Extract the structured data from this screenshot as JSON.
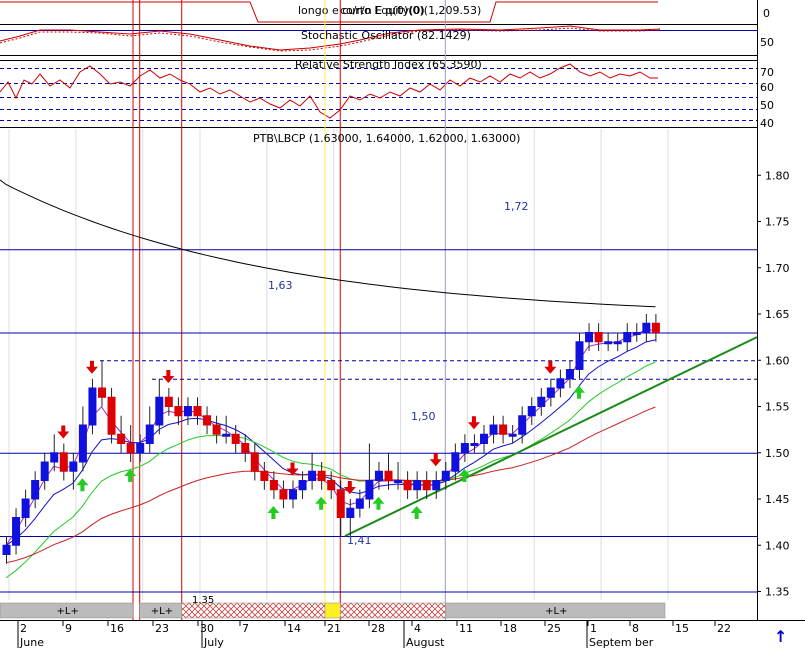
{
  "colors": {
    "up": "#1111dd",
    "down": "#dd0000",
    "sell_arrow": "#dd0000",
    "buy_arrow": "#22cc22",
    "sma_black": "#000000",
    "ema_fast": "#aa22cc",
    "ema_mid": "#1111cc",
    "ema_green": "#22cc22",
    "ema_red": "#cc2222",
    "trend": "#1a8a1a",
    "hline": "#0000aa",
    "vline_red": "#dd0000",
    "vline_yellow": "#ffee44",
    "vline_gray": "#9999cc"
  },
  "panels": {
    "equity": {
      "title": "longo e curto Equity(0)",
      "title_overlay": "co/r/n E q(0)(0)(1,209.53)",
      "y_tick": "0"
    },
    "stochastic": {
      "title": "Stochastic Oscillator (82.1429)",
      "y_tick": "50"
    },
    "rsi": {
      "title": "Relative Strength Index (65.3590)",
      "y_ticks": [
        "70",
        "60",
        "50",
        "40"
      ]
    },
    "price": {
      "title": "PTB\\LBCP (1.63000, 1.64000, 1.62000, 1.63000)"
    }
  },
  "scroll_arrow": "↑",
  "chart_data": {
    "type": "candlestick",
    "title": "PTB\\LBCP (1.63000, 1.64000, 1.62000, 1.63000)",
    "ylim": [
      1.33,
      1.85
    ],
    "y_ticks": [
      "1.80",
      "1.75",
      "1.70",
      "1.65",
      "1.60",
      "1.55",
      "1.50",
      "1.45",
      "1.40",
      "1.35"
    ],
    "x_tick_labels": [
      "2",
      "9",
      "16",
      "23",
      "30",
      "7",
      "14",
      "21",
      "28",
      "4",
      "11",
      "18",
      "25",
      "1",
      "8",
      "15",
      "22"
    ],
    "month_labels": [
      "June",
      "July",
      "August",
      "Septem ber"
    ],
    "ohlc": [
      [
        1.39,
        1.41,
        1.38,
        1.4
      ],
      [
        1.4,
        1.44,
        1.39,
        1.43
      ],
      [
        1.43,
        1.46,
        1.42,
        1.45
      ],
      [
        1.45,
        1.48,
        1.44,
        1.47
      ],
      [
        1.47,
        1.5,
        1.46,
        1.49
      ],
      [
        1.49,
        1.52,
        1.48,
        1.5
      ],
      [
        1.5,
        1.51,
        1.47,
        1.48
      ],
      [
        1.48,
        1.5,
        1.46,
        1.49
      ],
      [
        1.49,
        1.55,
        1.48,
        1.53
      ],
      [
        1.53,
        1.58,
        1.52,
        1.57
      ],
      [
        1.57,
        1.6,
        1.55,
        1.56
      ],
      [
        1.56,
        1.57,
        1.51,
        1.52
      ],
      [
        1.52,
        1.54,
        1.5,
        1.51
      ],
      [
        1.51,
        1.53,
        1.49,
        1.5
      ],
      [
        1.5,
        1.52,
        1.49,
        1.51
      ],
      [
        1.51,
        1.55,
        1.5,
        1.53
      ],
      [
        1.53,
        1.58,
        1.52,
        1.56
      ],
      [
        1.56,
        1.57,
        1.54,
        1.55
      ],
      [
        1.55,
        1.56,
        1.53,
        1.54
      ],
      [
        1.54,
        1.56,
        1.53,
        1.55
      ],
      [
        1.55,
        1.56,
        1.53,
        1.54
      ],
      [
        1.54,
        1.55,
        1.52,
        1.53
      ],
      [
        1.53,
        1.54,
        1.51,
        1.52
      ],
      [
        1.52,
        1.54,
        1.51,
        1.52
      ],
      [
        1.52,
        1.53,
        1.5,
        1.51
      ],
      [
        1.51,
        1.52,
        1.49,
        1.5
      ],
      [
        1.5,
        1.51,
        1.47,
        1.48
      ],
      [
        1.48,
        1.49,
        1.46,
        1.47
      ],
      [
        1.47,
        1.48,
        1.45,
        1.46
      ],
      [
        1.46,
        1.47,
        1.44,
        1.45
      ],
      [
        1.45,
        1.47,
        1.44,
        1.46
      ],
      [
        1.46,
        1.48,
        1.45,
        1.47
      ],
      [
        1.47,
        1.5,
        1.46,
        1.48
      ],
      [
        1.48,
        1.49,
        1.46,
        1.47
      ],
      [
        1.47,
        1.48,
        1.45,
        1.46
      ],
      [
        1.46,
        1.47,
        1.41,
        1.43
      ],
      [
        1.43,
        1.45,
        1.41,
        1.44
      ],
      [
        1.44,
        1.46,
        1.43,
        1.45
      ],
      [
        1.45,
        1.51,
        1.44,
        1.47
      ],
      [
        1.47,
        1.49,
        1.46,
        1.48
      ],
      [
        1.48,
        1.5,
        1.46,
        1.47
      ],
      [
        1.47,
        1.49,
        1.46,
        1.47
      ],
      [
        1.47,
        1.48,
        1.45,
        1.46
      ],
      [
        1.46,
        1.48,
        1.45,
        1.47
      ],
      [
        1.47,
        1.48,
        1.45,
        1.46
      ],
      [
        1.46,
        1.48,
        1.45,
        1.47
      ],
      [
        1.47,
        1.49,
        1.46,
        1.48
      ],
      [
        1.48,
        1.51,
        1.47,
        1.5
      ],
      [
        1.5,
        1.52,
        1.49,
        1.51
      ],
      [
        1.51,
        1.52,
        1.5,
        1.51
      ],
      [
        1.51,
        1.53,
        1.5,
        1.52
      ],
      [
        1.52,
        1.54,
        1.51,
        1.53
      ],
      [
        1.53,
        1.54,
        1.51,
        1.52
      ],
      [
        1.52,
        1.53,
        1.51,
        1.52
      ],
      [
        1.52,
        1.55,
        1.51,
        1.54
      ],
      [
        1.54,
        1.56,
        1.53,
        1.55
      ],
      [
        1.55,
        1.57,
        1.54,
        1.56
      ],
      [
        1.56,
        1.58,
        1.55,
        1.57
      ],
      [
        1.57,
        1.59,
        1.56,
        1.58
      ],
      [
        1.58,
        1.6,
        1.57,
        1.59
      ],
      [
        1.59,
        1.63,
        1.58,
        1.62
      ],
      [
        1.62,
        1.64,
        1.61,
        1.63
      ],
      [
        1.63,
        1.64,
        1.61,
        1.62
      ],
      [
        1.62,
        1.63,
        1.61,
        1.62
      ],
      [
        1.62,
        1.63,
        1.61,
        1.62
      ],
      [
        1.62,
        1.64,
        1.61,
        1.63
      ],
      [
        1.63,
        1.64,
        1.62,
        1.63
      ],
      [
        1.63,
        1.65,
        1.62,
        1.64
      ],
      [
        1.64,
        1.65,
        1.62,
        1.63
      ]
    ],
    "horizontal_levels": [
      {
        "value": 1.72,
        "label": "1,72",
        "style": "solid"
      },
      {
        "value": 1.63,
        "label": "1,63",
        "style": "solid"
      },
      {
        "value": 1.6,
        "label": "",
        "style": "dashed"
      },
      {
        "value": 1.58,
        "label": "",
        "style": "dashed"
      },
      {
        "value": 1.5,
        "label": "1,50",
        "style": "solid"
      },
      {
        "value": 1.41,
        "label": "1,41",
        "style": "solid"
      },
      {
        "value": 1.35,
        "label": "",
        "style": "solid"
      }
    ],
    "trendline": {
      "from": [
        35.5,
        1.41
      ],
      "to": [
        80,
        1.625
      ]
    },
    "sell_signals": [
      6,
      9,
      17,
      30,
      36,
      45,
      49,
      57
    ],
    "buy_signals": [
      8,
      13,
      28,
      33,
      39,
      43,
      48,
      60
    ],
    "position_bands": [
      {
        "label": "+L+",
        "type": "long"
      },
      {
        "label": "+L+",
        "type": "long"
      },
      {
        "label": "",
        "type": "flat"
      },
      {
        "label": "",
        "type": "yellow"
      },
      {
        "label": "",
        "type": "flat"
      },
      {
        "label": "+L+",
        "type": "long"
      }
    ],
    "band_partial_label": "1.35"
  }
}
